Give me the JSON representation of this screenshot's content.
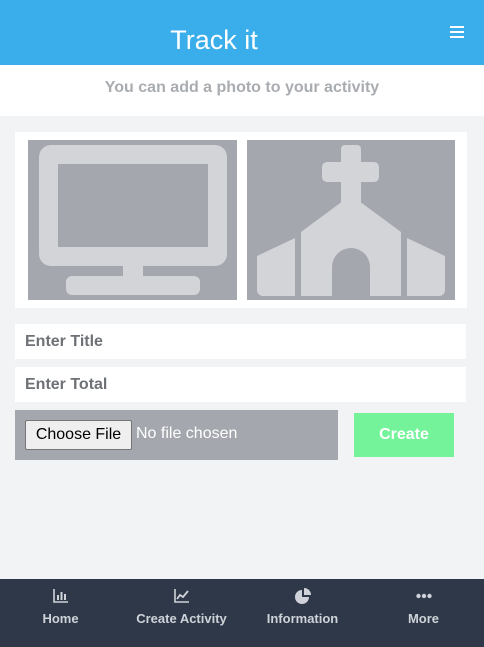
{
  "header": {
    "title": "Track it",
    "menu_icon": "hamburger-menu-icon"
  },
  "subtitle": "You can add a photo to your activity",
  "photos": [
    {
      "icon": "desktop-monitor-icon"
    },
    {
      "icon": "church-icon"
    }
  ],
  "form": {
    "title_placeholder": "Enter Title",
    "title_value": "",
    "total_placeholder": "Enter Total",
    "total_value": "",
    "choose_file_label": "Choose File",
    "file_status": "No file chosen",
    "create_label": "Create"
  },
  "nav": {
    "items": [
      {
        "label": "Home",
        "icon": "bar-chart-icon"
      },
      {
        "label": "Create Activity",
        "icon": "line-chart-icon"
      },
      {
        "label": "Information",
        "icon": "pie-chart-icon"
      },
      {
        "label": "More",
        "icon": "ellipsis-icon"
      }
    ]
  },
  "colors": {
    "header_bg": "#3aaeea",
    "create_button_bg": "#74f39a",
    "nav_bg": "#2e3848",
    "page_bg": "#f2f3f5",
    "photo_tile_bg": "#a4a7ad"
  }
}
